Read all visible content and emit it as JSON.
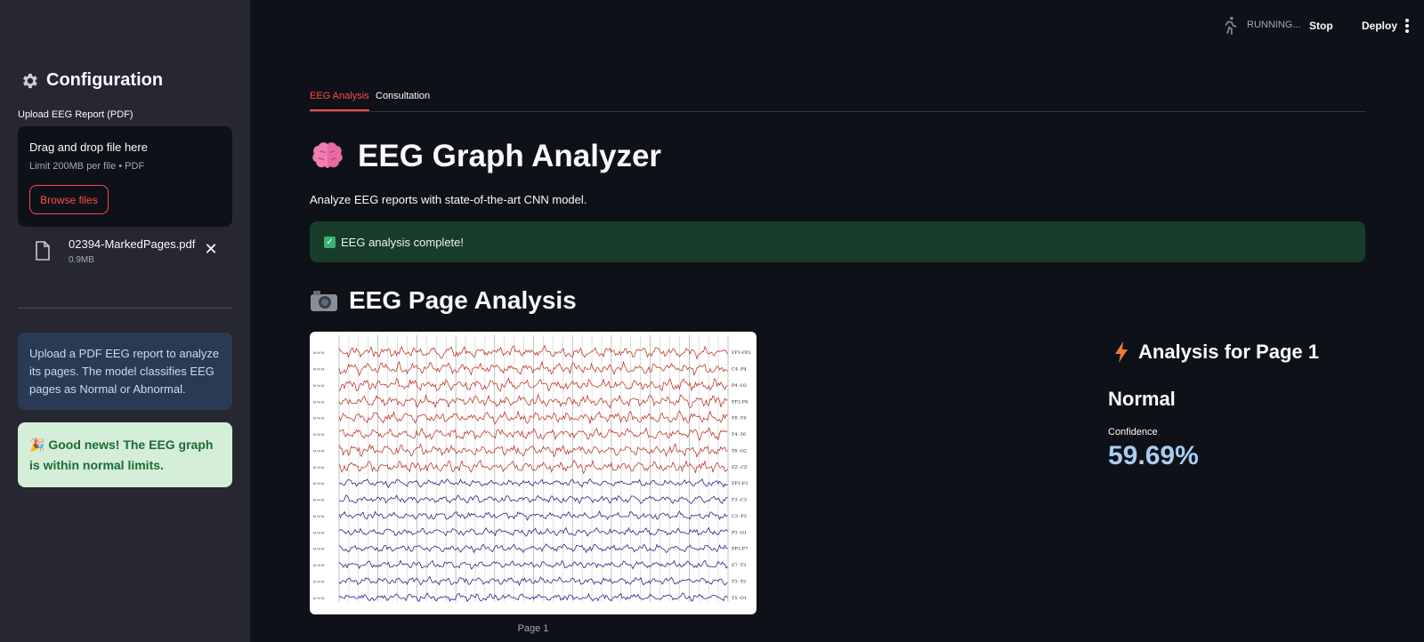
{
  "sidebar": {
    "title": "Configuration",
    "upload_label": "Upload EEG Report (PDF)",
    "dropzone_title": "Drag and drop file here",
    "dropzone_limit": "Limit 200MB per file • PDF",
    "browse_button": "Browse files",
    "file": {
      "name": "02394-MarkedPages.pdf",
      "size": "0.9MB"
    },
    "info_text": "Upload a PDF EEG report to analyze its pages. The model classifies EEG pages as Normal or Abnormal.",
    "success_text": "🎉 Good news! The EEG graph is within normal limits."
  },
  "topbar": {
    "status": "RUNNING...",
    "stop_label": "Stop",
    "deploy_label": "Deploy"
  },
  "tabs": [
    {
      "label": "EEG Analysis",
      "active": true
    },
    {
      "label": "Consultation",
      "active": false
    }
  ],
  "main": {
    "title": "EEG Graph Analyzer",
    "subtitle": "Analyze EEG reports with state-of-the-art CNN model.",
    "status_message": "EEG analysis complete!",
    "section_title": "EEG Page Analysis",
    "image_caption": "Page 1",
    "analysis_title": "Analysis for Page 1",
    "classification": "Normal",
    "confidence_label": "Confidence",
    "confidence_value": "59.69%"
  },
  "eeg_channels": [
    "FP1-FP2",
    "C4 -P4",
    "P4 -O2",
    "FP2-F8",
    "F8 -T4",
    "T4 -T6",
    "T6 -O2",
    "FZ -CZ",
    "FP1-F3",
    "F3 -C3",
    "C3 -P3",
    "P3 -O1",
    "FP1-F7",
    "F7 -T3",
    "T3 -T5",
    "T5 -O1"
  ],
  "colors": {
    "accent": "#ff4b4b",
    "trace_red": "#c0392b",
    "trace_blue": "#1f2a8a",
    "confidence": "#a9cdf0"
  }
}
